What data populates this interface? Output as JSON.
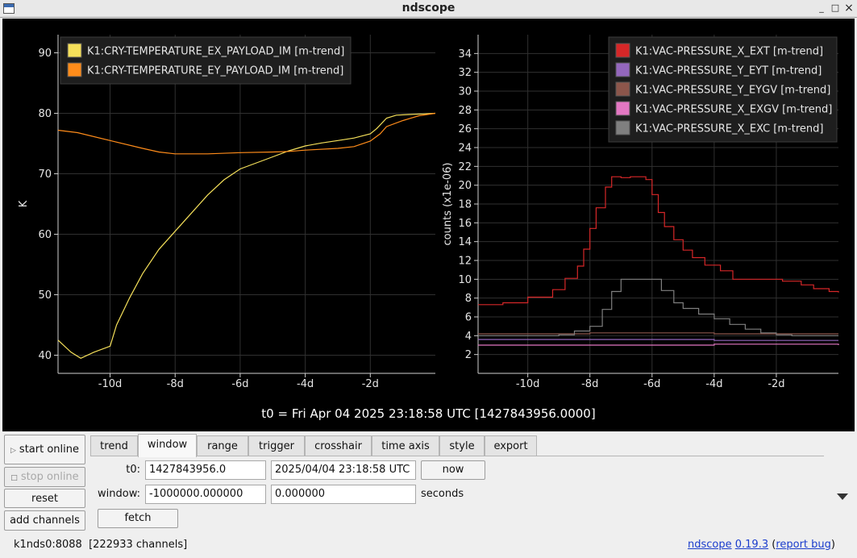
{
  "window": {
    "title": "ndscope",
    "icon": "app-window-icon",
    "controls": {
      "minimize": "_",
      "maximize": "□",
      "close": "×"
    }
  },
  "t0_label": "t0 = Fri Apr 04 2025 23:18:58 UTC [1427843956.0000]",
  "left_plot": {
    "ylabel": "K",
    "yticks": [
      40,
      50,
      60,
      70,
      80,
      90
    ],
    "xticks": [
      "-10d",
      "-8d",
      "-6d",
      "-4d",
      "-2d"
    ],
    "legend": [
      {
        "name": "K1:CRY-TEMPERATURE_EX_PAYLOAD_IM [m-trend]",
        "color": "#f5e05a"
      },
      {
        "name": "K1:CRY-TEMPERATURE_EY_PAYLOAD_IM [m-trend]",
        "color": "#ff8c1a"
      }
    ]
  },
  "right_plot": {
    "ylabel": "counts (x1e-06)",
    "yticks": [
      2,
      4,
      6,
      8,
      10,
      12,
      14,
      16,
      18,
      20,
      22,
      24,
      26,
      28,
      30,
      32,
      34
    ],
    "xticks": [
      "-10d",
      "-8d",
      "-6d",
      "-4d",
      "-2d"
    ],
    "legend": [
      {
        "name": "K1:VAC-PRESSURE_X_EXT [m-trend]",
        "color": "#d62728"
      },
      {
        "name": "K1:VAC-PRESSURE_Y_EYT [m-trend]",
        "color": "#9467bd"
      },
      {
        "name": "K1:VAC-PRESSURE_Y_EYGV [m-trend]",
        "color": "#8c564b"
      },
      {
        "name": "K1:VAC-PRESSURE_X_EXGV [m-trend]",
        "color": "#e377c2"
      },
      {
        "name": "K1:VAC-PRESSURE_X_EXC [m-trend]",
        "color": "#7f7f7f"
      }
    ]
  },
  "chart_data": [
    {
      "type": "line",
      "xlabel": "",
      "ylabel": "K",
      "xlim": [
        -11.6,
        0
      ],
      "ylim": [
        37,
        93
      ],
      "series": [
        {
          "name": "K1:CRY-TEMPERATURE_EX_PAYLOAD_IM [m-trend]",
          "x": [
            -11.6,
            -11.2,
            -10.9,
            -10.5,
            -10.0,
            -9.8,
            -9.4,
            -9.0,
            -8.5,
            -8.0,
            -7.5,
            -7.0,
            -6.5,
            -6.0,
            -5.5,
            -5.0,
            -4.5,
            -4.0,
            -3.5,
            -3.0,
            -2.5,
            -2.0,
            -1.8,
            -1.5,
            -1.2,
            -0.8,
            -0.4,
            0.0
          ],
          "y": [
            42.5,
            40.5,
            39.5,
            40.5,
            41.5,
            45,
            49.5,
            53.5,
            57.5,
            60.5,
            63.5,
            66.5,
            69,
            70.8,
            71.8,
            72.8,
            73.8,
            74.6,
            75.1,
            75.5,
            75.9,
            76.6,
            77.5,
            79.2,
            79.7,
            79.8,
            79.9,
            80.0
          ]
        },
        {
          "name": "K1:CRY-TEMPERATURE_EY_PAYLOAD_IM [m-trend]",
          "x": [
            -11.6,
            -11.0,
            -10.0,
            -9.0,
            -8.5,
            -8.0,
            -7.0,
            -6.0,
            -5.0,
            -4.5,
            -4.0,
            -3.0,
            -2.5,
            -2.0,
            -1.7,
            -1.5,
            -1.0,
            -0.5,
            0.0
          ],
          "y": [
            77.2,
            76.8,
            75.5,
            74.2,
            73.6,
            73.3,
            73.3,
            73.5,
            73.6,
            73.7,
            73.9,
            74.2,
            74.5,
            75.4,
            76.6,
            77.8,
            78.8,
            79.6,
            80.0
          ]
        }
      ]
    },
    {
      "type": "line",
      "xlabel": "",
      "ylabel": "counts (x1e-06)",
      "xlim": [
        -11.6,
        0
      ],
      "ylim": [
        0,
        36
      ],
      "series": [
        {
          "name": "K1:VAC-PRESSURE_X_EXT [m-trend]",
          "x": [
            -11.6,
            -10.8,
            -10.0,
            -9.2,
            -8.8,
            -8.4,
            -8.2,
            -8.0,
            -7.8,
            -7.5,
            -7.3,
            -7.0,
            -6.7,
            -6.4,
            -6.2,
            -6.0,
            -5.8,
            -5.6,
            -5.3,
            -5.0,
            -4.7,
            -4.3,
            -3.8,
            -3.4,
            -3.0,
            -2.6,
            -2.2,
            -1.8,
            -1.2,
            -0.8,
            -0.3,
            0.0
          ],
          "y": [
            7.3,
            7.5,
            8.1,
            8.9,
            10.1,
            11.4,
            13.2,
            15.4,
            17.6,
            19.8,
            20.9,
            20.8,
            20.9,
            20.9,
            20.6,
            19.0,
            17.1,
            15.6,
            14.2,
            13.1,
            12.3,
            11.5,
            10.9,
            10.0,
            10.0,
            10.0,
            10.0,
            9.8,
            9.4,
            9.0,
            8.7,
            8.6
          ]
        },
        {
          "name": "K1:VAC-PRESSURE_Y_EYT [m-trend]",
          "x": [
            -11.6,
            -8.0,
            -4.0,
            0.0
          ],
          "y": [
            3.6,
            3.6,
            3.5,
            3.5
          ]
        },
        {
          "name": "K1:VAC-PRESSURE_Y_EYGV [m-trend]",
          "x": [
            -11.6,
            -8.0,
            -4.0,
            0.0
          ],
          "y": [
            4.2,
            4.3,
            4.2,
            4.2
          ]
        },
        {
          "name": "K1:VAC-PRESSURE_X_EXGV [m-trend]",
          "x": [
            -11.6,
            -8.0,
            -4.0,
            0.0
          ],
          "y": [
            3.0,
            3.0,
            3.1,
            3.0
          ]
        },
        {
          "name": "K1:VAC-PRESSURE_X_EXC [m-trend]",
          "x": [
            -11.6,
            -9.5,
            -9.0,
            -8.5,
            -8.0,
            -7.6,
            -7.3,
            -7.0,
            -6.5,
            -6.0,
            -5.7,
            -5.3,
            -5.0,
            -4.5,
            -4.0,
            -3.5,
            -3.0,
            -2.5,
            -2.0,
            -1.5,
            0.0
          ],
          "y": [
            4.0,
            4.0,
            4.1,
            4.5,
            5.0,
            6.8,
            8.7,
            10.0,
            10.0,
            10.0,
            8.8,
            7.5,
            6.9,
            6.3,
            5.8,
            5.2,
            4.7,
            4.3,
            4.1,
            4.0,
            4.0
          ]
        }
      ]
    }
  ],
  "side_buttons": {
    "start_online": "start online",
    "stop_online": "stop online",
    "reset": "reset",
    "add_channels": "add channels"
  },
  "tabs": [
    "trend",
    "window",
    "range",
    "trigger",
    "crosshair",
    "time axis",
    "style",
    "export"
  ],
  "window_tab": {
    "t0_label": "t0:",
    "t0_value": "1427843956.0",
    "t0_date": "2025/04/04 23:18:58 UTC",
    "now_label": "now",
    "window_label": "window:",
    "window_start": "-1000000.000000",
    "window_end": "0.000000",
    "seconds_label": "seconds",
    "fetch_label": "fetch"
  },
  "status": {
    "server": "k1nds0:8088",
    "channels": "[222933 channels]",
    "app_name": "ndscope",
    "version": "0.19.3",
    "paren_open": "(",
    "report_bug": "report bug",
    "paren_close": ")"
  }
}
